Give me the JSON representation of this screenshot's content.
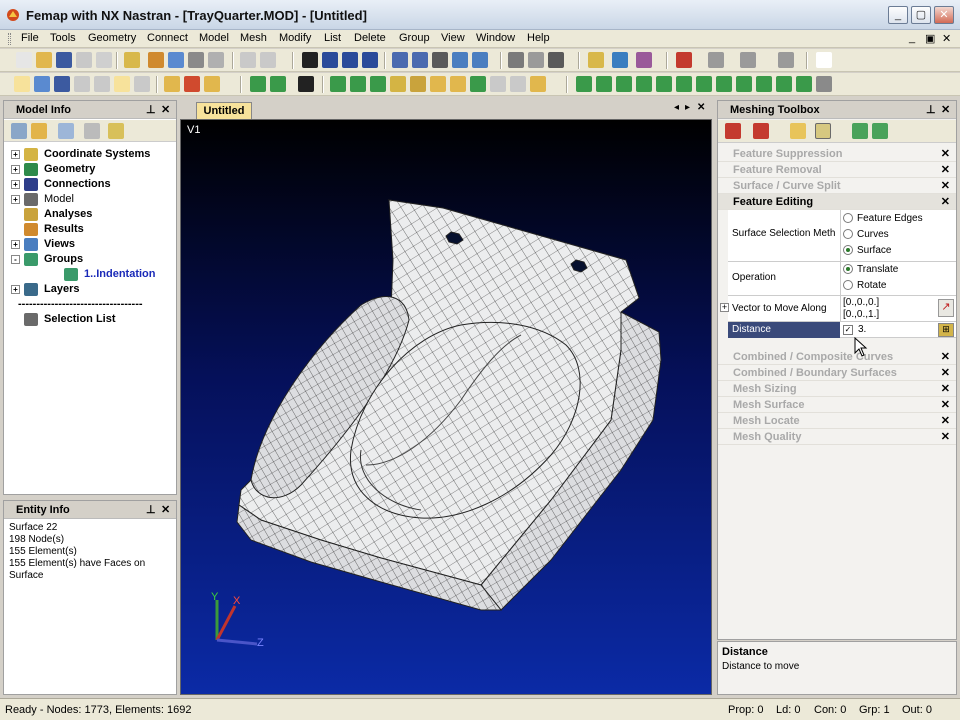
{
  "window": {
    "title": "Femap with NX Nastran - [TrayQuarter.MOD] - [Untitled]"
  },
  "menu": {
    "items": [
      "File",
      "Tools",
      "Geometry",
      "Connect",
      "Model",
      "Mesh",
      "Modify",
      "List",
      "Delete",
      "Group",
      "View",
      "Window",
      "Help"
    ]
  },
  "model_info": {
    "title": "Model Info",
    "tree": [
      {
        "label": "Coordinate Systems",
        "exp": "+",
        "icon": "coordinate-systems-icon"
      },
      {
        "label": "Geometry",
        "exp": "+",
        "icon": "geometry-icon"
      },
      {
        "label": "Connections",
        "exp": "+",
        "icon": "connections-icon"
      },
      {
        "label": "Model",
        "exp": "+",
        "icon": "model-icon"
      },
      {
        "label": "Analyses",
        "exp": "",
        "icon": "analyses-icon"
      },
      {
        "label": "Results",
        "exp": "",
        "icon": "results-icon"
      },
      {
        "label": "Views",
        "exp": "+",
        "icon": "views-icon"
      },
      {
        "label": "Groups",
        "exp": "-",
        "icon": "groups-icon"
      },
      {
        "label": "1..Indentation",
        "exp": "",
        "icon": "group-item-icon"
      },
      {
        "label": "Layers",
        "exp": "+",
        "icon": "layers-icon"
      },
      {
        "label": "----------------------------------",
        "exp": "",
        "icon": ""
      },
      {
        "label": "Selection List",
        "exp": "",
        "icon": "selection-list-icon"
      }
    ]
  },
  "entity_info": {
    "title": "Entity Info",
    "lines": [
      "Surface 22",
      "198 Node(s)",
      "155 Element(s)",
      "155 Element(s) have Faces on",
      "Surface"
    ]
  },
  "graphics": {
    "tab": "Untitled",
    "view_label": "V1",
    "axis_x": "X",
    "axis_y": "Y",
    "axis_z": "Z"
  },
  "meshing_toolbox": {
    "title": "Meshing Toolbox",
    "top_sections": [
      "Feature Suppression",
      "Feature Removal",
      "Surface / Curve Split"
    ],
    "active_section": "Feature Editing",
    "props": {
      "surface_selection_label": "Surface Selection Meth",
      "surface_selection_options": [
        "Feature Edges",
        "Curves",
        "Surface"
      ],
      "surface_selection_value": "Surface",
      "operation_label": "Operation",
      "operation_options": [
        "Translate",
        "Rotate"
      ],
      "operation_value": "Translate",
      "vector_label": "Vector to Move Along",
      "vector_value_1": "[0.,0.,0.]",
      "vector_value_2": "[0.,0.,1.]",
      "distance_label": "Distance",
      "distance_value": "3."
    },
    "bottom_sections": [
      "Combined / Composite Curves",
      "Combined / Boundary Surfaces",
      "Mesh Sizing",
      "Mesh Surface",
      "Mesh Locate",
      "Mesh Quality"
    ],
    "help_title": "Distance",
    "help_text": "Distance to move"
  },
  "status": {
    "main": "Ready - Nodes: 1773,  Elements: 1692",
    "prop": "Prop: 0",
    "ld": "Ld: 0",
    "con": "Con: 0",
    "grp": "Grp: 1",
    "out": "Out: 0"
  }
}
